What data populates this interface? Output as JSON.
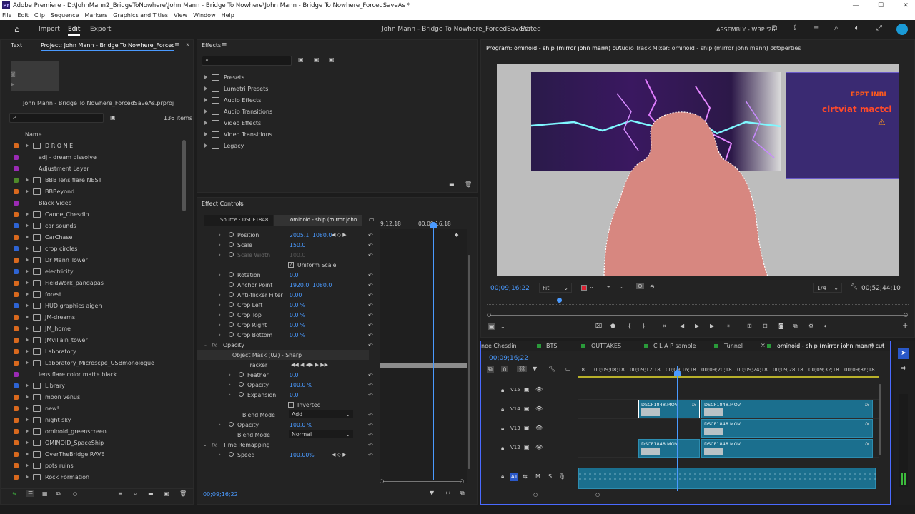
{
  "window": {
    "title": "Adobe Premiere - D:\\JohnMann2_BridgeToNowhere\\John Mann - Bridge To Nowhere\\John Mann - Bridge To Nowhere_ForcedSaveAs *",
    "app_badge": "Pr"
  },
  "menu": [
    "File",
    "Edit",
    "Clip",
    "Sequence",
    "Markers",
    "Graphics and Titles",
    "View",
    "Window",
    "Help"
  ],
  "header": {
    "nav": [
      "Import",
      "Edit",
      "Export"
    ],
    "project_title": "John Mann - Bridge To Nowhere_ForcedSaveAs",
    "edited": "- Edited",
    "workspace": "ASSEMBLY - WBP '26"
  },
  "project": {
    "tab_text": "Text",
    "tab_project": "Project: John Mann - Bridge To Nowhere_ForcedSaveAs",
    "file": "John Mann - Bridge To Nowhere_ForcedSaveAs.prproj",
    "count": "136 items",
    "column_name": "Name",
    "items": [
      {
        "name": "D R O N E",
        "color": "#d9691e",
        "folder": true
      },
      {
        "name": "adj - dream dissolve",
        "color": "#9b2bb5",
        "folder": false
      },
      {
        "name": "Adjustment Layer",
        "color": "#9b2bb5",
        "folder": false
      },
      {
        "name": "BBB lens flare NEST",
        "color": "#4e8a2a",
        "folder": true
      },
      {
        "name": "BBBeyond",
        "color": "#d9691e",
        "folder": true
      },
      {
        "name": "Black Video",
        "color": "#9b2bb5",
        "folder": false
      },
      {
        "name": "Canoe_Chesdin",
        "color": "#d9691e",
        "folder": true
      },
      {
        "name": "car sounds",
        "color": "#2e64d4",
        "folder": true
      },
      {
        "name": "CarChase",
        "color": "#d9691e",
        "folder": true
      },
      {
        "name": "crop circles",
        "color": "#2e64d4",
        "folder": true
      },
      {
        "name": "Dr Mann Tower",
        "color": "#d9691e",
        "folder": true
      },
      {
        "name": "electricity",
        "color": "#2e64d4",
        "folder": true
      },
      {
        "name": "FieldWork_pandapas",
        "color": "#d9691e",
        "folder": true
      },
      {
        "name": "forest",
        "color": "#d9691e",
        "folder": true
      },
      {
        "name": "HUD graphics aigen",
        "color": "#2e64d4",
        "folder": true
      },
      {
        "name": "JM-dreams",
        "color": "#d9691e",
        "folder": true
      },
      {
        "name": "JM_home",
        "color": "#d9691e",
        "folder": true
      },
      {
        "name": "JMvillain_tower",
        "color": "#d9691e",
        "folder": true
      },
      {
        "name": "Laboratory",
        "color": "#d9691e",
        "folder": true
      },
      {
        "name": "Laboratory_Microscpe_USBmonologue",
        "color": "#d9691e",
        "folder": true
      },
      {
        "name": "lens flare color matte black",
        "color": "#9b2bb5",
        "folder": false
      },
      {
        "name": "Library",
        "color": "#2e64d4",
        "folder": true
      },
      {
        "name": "moon venus",
        "color": "#d9691e",
        "folder": true
      },
      {
        "name": "new!",
        "color": "#d9691e",
        "folder": true
      },
      {
        "name": "night sky",
        "color": "#d9691e",
        "folder": true
      },
      {
        "name": "ominoid_greenscreen",
        "color": "#d9691e",
        "folder": true
      },
      {
        "name": "OMINOID_SpaceShip",
        "color": "#d9691e",
        "folder": true
      },
      {
        "name": "OverTheBridge RAVE",
        "color": "#d9691e",
        "folder": true
      },
      {
        "name": "pots ruins",
        "color": "#d9691e",
        "folder": true
      },
      {
        "name": "Rock Formation",
        "color": "#d9691e",
        "folder": true
      }
    ]
  },
  "effects": {
    "tab": "Effects",
    "items": [
      "Presets",
      "Lumetri Presets",
      "Audio Effects",
      "Audio Transitions",
      "Video Effects",
      "Video Transitions",
      "Legacy"
    ]
  },
  "effect_controls": {
    "tab": "Effect Controls",
    "source_tab": "Source · DSCF1848...",
    "seq_tab": "ominoid - ship (mirror john...",
    "ruler_a": "9:12:18",
    "ruler_b": "00:09:16:18",
    "timecode": "00;09;16;22",
    "rows": [
      {
        "label": "Position",
        "v1": "2005.1",
        "v2": "1080.0",
        "indent": 1,
        "tri": true,
        "stop": true
      },
      {
        "label": "Scale",
        "v1": "150.0",
        "v2": "",
        "indent": 1,
        "tri": true,
        "stop": true
      },
      {
        "label": "Scale Width",
        "v1": "100.0",
        "v2": "",
        "indent": 1,
        "tri": true,
        "stop": true,
        "dim": true
      },
      {
        "label": "",
        "v1": "",
        "v2": "",
        "indent": 1,
        "check": "Uniform Scale"
      },
      {
        "label": "Rotation",
        "v1": "0.0",
        "v2": "",
        "indent": 1,
        "tri": true,
        "stop": true
      },
      {
        "label": "Anchor Point",
        "v1": "1920.0",
        "v2": "1080.0",
        "indent": 1,
        "tri": false,
        "stop": true
      },
      {
        "label": "Anti-flicker Filter",
        "v1": "0.00",
        "v2": "",
        "indent": 1,
        "tri": true,
        "stop": true
      },
      {
        "label": "Crop Left",
        "v1": "0.0 %",
        "v2": "",
        "indent": 1,
        "tri": true,
        "stop": true
      },
      {
        "label": "Crop Top",
        "v1": "0.0 %",
        "v2": "",
        "indent": 1,
        "tri": true,
        "stop": true
      },
      {
        "label": "Crop Right",
        "v1": "0.0 %",
        "v2": "",
        "indent": 1,
        "tri": true,
        "stop": true
      },
      {
        "label": "Crop Bottom",
        "v1": "0.0 %",
        "v2": "",
        "indent": 1,
        "tri": true,
        "stop": true
      },
      {
        "label": "Opacity",
        "v1": "",
        "v2": "",
        "indent": 0,
        "fx": true
      },
      {
        "label": "Object Mask (02) - Sharp",
        "v1": "",
        "v2": "",
        "indent": 0.5,
        "sel": true
      },
      {
        "label": "Tracker",
        "v1": "",
        "v2": "",
        "indent": 2
      },
      {
        "label": "Feather",
        "v1": "0.0",
        "v2": "",
        "indent": 2,
        "tri": true,
        "stop": true
      },
      {
        "label": "Opacity",
        "v1": "100.0 %",
        "v2": "",
        "indent": 2,
        "tri": true,
        "stop": true
      },
      {
        "label": "Expansion",
        "v1": "0.0",
        "v2": "",
        "indent": 2,
        "tri": true,
        "stop": true
      },
      {
        "label": "",
        "v1": "",
        "v2": "",
        "indent": 2,
        "check": "Inverted"
      },
      {
        "label": "Blend Mode",
        "v1": "Add",
        "v2": "",
        "indent": 1.5,
        "drop": true
      },
      {
        "label": "Opacity",
        "v1": "100.0 %",
        "v2": "",
        "indent": 1,
        "tri": true,
        "stop": true
      },
      {
        "label": "Blend Mode",
        "v1": "Normal",
        "v2": "",
        "indent": 1,
        "drop": true
      },
      {
        "label": "Time Remapping",
        "v1": "",
        "v2": "",
        "indent": 0,
        "fx": true
      },
      {
        "label": "Speed",
        "v1": "100.00%",
        "v2": "",
        "indent": 1,
        "tri": true,
        "stop": true
      }
    ]
  },
  "program": {
    "tab": "Program: ominoid - ship (mirror john mann) cut",
    "mixer_tab": "Audio Track Mixer: ominoid - ship (mirror john mann) cut",
    "props_tab": "Properties",
    "timecode": "00;09;16;22",
    "fit": "Fit",
    "quality": "1/4",
    "duration": "00;52;44;10",
    "hud_warn": "EPPT INBI",
    "hud_text": "clrtviat mactcl"
  },
  "timeline": {
    "tabs": [
      "noe Chesdin",
      "BTS",
      "OUTTAKES",
      "C L A P sample",
      "Tunnel",
      "ominoid - ship (mirror john mann) cut"
    ],
    "timecode": "00;09;16;22",
    "ruler": [
      "18",
      "00;09;08;18",
      "00;09;12;18",
      "00;09;16;18",
      "00;09;20;18",
      "00;09;24;18",
      "00;09;28;18",
      "00;09;32;18",
      "00;09;36;18"
    ],
    "tracks": [
      "V15",
      "V14",
      "V13",
      "V12"
    ],
    "audio": "A1",
    "clip": "DSCF1848.MOV"
  }
}
